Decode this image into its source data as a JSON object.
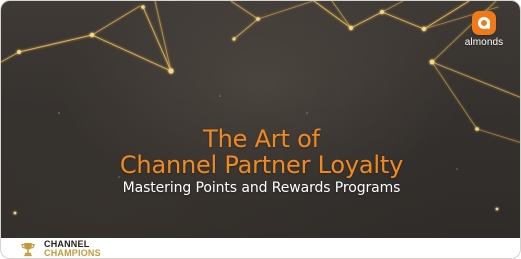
{
  "brand": {
    "logo_text": "almonds",
    "accent_color": "#f07a1a"
  },
  "hero": {
    "title_line1": "The Art of",
    "title_line2": "Channel Partner Loyalty",
    "subtitle": "Mastering Points and Rewards Programs",
    "title_color": "#f0891f",
    "subtitle_color": "#ffffff",
    "background_color": "#35312e"
  },
  "footer": {
    "badge_line1": "CHANNEL",
    "badge_line2": "CHAMPIONS",
    "badge_line2_color": "#c49a3a",
    "badge_icon": "trophy-icon"
  }
}
